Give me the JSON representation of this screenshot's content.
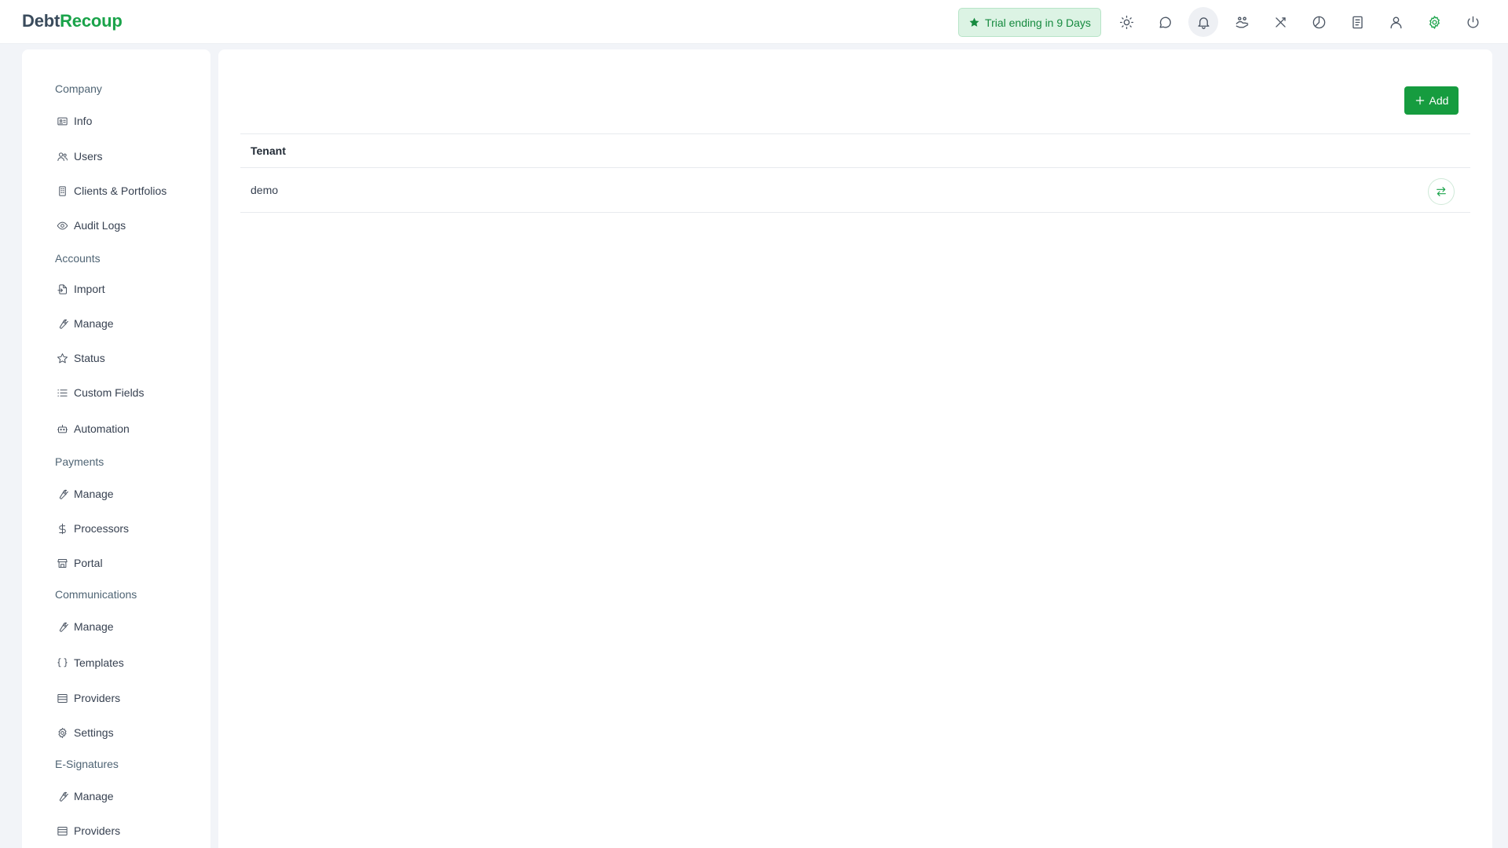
{
  "app": {
    "logo_part1": "Debt",
    "logo_part2": "Recoup"
  },
  "header": {
    "trial_text": "Trial ending in 9 Days",
    "icons": [
      "sun-icon",
      "chat-icon",
      "bell-icon",
      "handshake-icon",
      "tools-icon",
      "chart-pie-icon",
      "report-icon",
      "user-icon",
      "settings-icon",
      "power-icon"
    ]
  },
  "sidebar": {
    "sections": [
      {
        "label": "Company",
        "items": [
          {
            "label": "Info",
            "icon": "id-card-icon"
          },
          {
            "label": "Users",
            "icon": "users-icon"
          },
          {
            "label": "Clients & Portfolios",
            "icon": "building-icon"
          },
          {
            "label": "Audit Logs",
            "icon": "eye-icon"
          }
        ]
      },
      {
        "label": "Accounts",
        "items": [
          {
            "label": "Import",
            "icon": "import-icon"
          },
          {
            "label": "Manage",
            "icon": "wrench-icon"
          },
          {
            "label": "Status",
            "icon": "star-icon"
          },
          {
            "label": "Custom Fields",
            "icon": "list-icon"
          },
          {
            "label": "Automation",
            "icon": "robot-icon"
          }
        ]
      },
      {
        "label": "Payments",
        "items": [
          {
            "label": "Manage",
            "icon": "wrench-icon"
          },
          {
            "label": "Processors",
            "icon": "dollar-icon"
          },
          {
            "label": "Portal",
            "icon": "store-icon"
          }
        ]
      },
      {
        "label": "Communications",
        "items": [
          {
            "label": "Manage",
            "icon": "wrench-icon"
          },
          {
            "label": "Templates",
            "icon": "braces-icon"
          },
          {
            "label": "Providers",
            "icon": "server-icon"
          },
          {
            "label": "Settings",
            "icon": "gear-icon"
          }
        ]
      },
      {
        "label": "E-Signatures",
        "items": [
          {
            "label": "Manage",
            "icon": "wrench-icon"
          },
          {
            "label": "Providers",
            "icon": "server-icon"
          }
        ]
      }
    ]
  },
  "main": {
    "add_label": "Add",
    "table": {
      "header": "Tenant",
      "rows": [
        {
          "tenant": "demo"
        }
      ]
    }
  },
  "colors": {
    "brand_green": "#1aa34a",
    "button_green": "#169c3f",
    "trial_bg": "#dcf3e4",
    "page_bg": "#f2f4f8"
  }
}
